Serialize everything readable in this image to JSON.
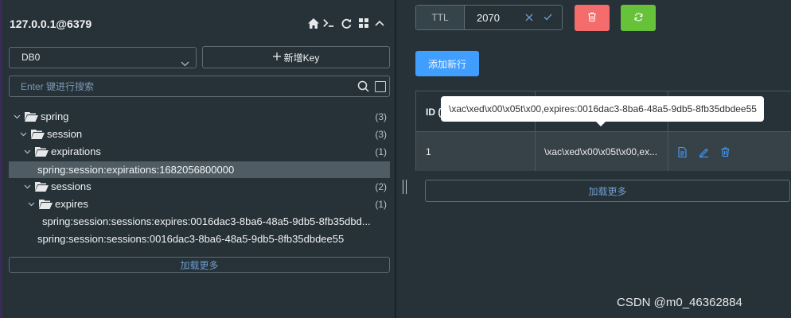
{
  "sidebar": {
    "connection_name": "127.0.0.1@6379",
    "header_icons": [
      "home-icon",
      "terminal-icon",
      "refresh-icon",
      "grid-icon",
      "chevron-up-icon"
    ],
    "db_select": {
      "value": "DB0"
    },
    "add_key_button": {
      "icon": "plus-icon",
      "label": "新增Key"
    },
    "search": {
      "placeholder": "Enter 键进行搜索",
      "value": ""
    },
    "tree": [
      {
        "label": "spring",
        "count": "(3)",
        "type": "folder",
        "expanded": true
      },
      {
        "label": "session",
        "count": "(3)",
        "type": "folder",
        "expanded": true
      },
      {
        "label": "expirations",
        "count": "(1)",
        "type": "folder",
        "expanded": true
      },
      {
        "label": "spring:session:expirations:1682056800000",
        "type": "key",
        "selected": true
      },
      {
        "label": "sessions",
        "count": "(2)",
        "type": "folder",
        "expanded": true
      },
      {
        "label": "expires",
        "count": "(1)",
        "type": "folder",
        "expanded": true
      },
      {
        "label": "spring:session:sessions:expires:0016dac3-8ba6-48a5-9db5-8fb35dbd...",
        "type": "key"
      },
      {
        "label": "spring:session:sessions:0016dac3-8ba6-48a5-9db5-8fb35dbdee55",
        "type": "key"
      }
    ],
    "load_more": "加载更多"
  },
  "main": {
    "ttl": {
      "label": "TTL",
      "value": "2070"
    },
    "delete_button": {
      "icon": "trash-icon",
      "color": "#f56c6c"
    },
    "refresh_button": {
      "icon": "refresh-icon",
      "color": "#67c23a"
    },
    "add_row_button": "添加新行",
    "table": {
      "header": {
        "id": "ID ("
      },
      "rows": [
        {
          "id": "1",
          "value": "\\xac\\xed\\x00\\x05t\\x00,ex..."
        }
      ],
      "row_actions": [
        "view-icon",
        "edit-icon",
        "delete-icon"
      ]
    },
    "tooltip": "\\xac\\xed\\x00\\x05t\\x00,expires:0016dac3-8ba6-48a5-9db5-8fb35dbdee55",
    "load_more": "加载更多"
  },
  "watermark": "CSDN @m0_46362884",
  "colors": {
    "background": "#263238",
    "accent": "#409eff",
    "danger": "#f56c6c",
    "success": "#67c23a"
  }
}
